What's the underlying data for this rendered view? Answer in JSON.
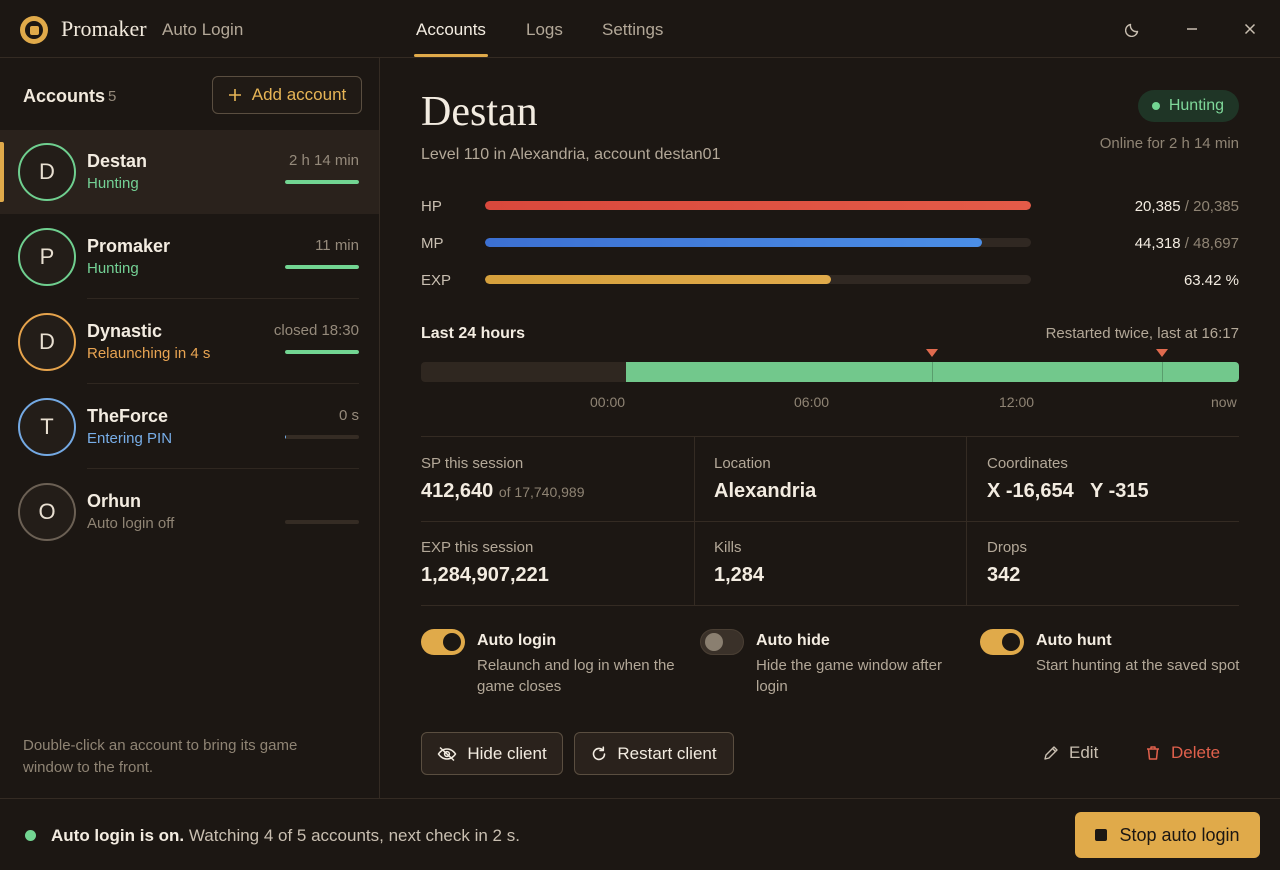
{
  "header": {
    "brand": "Promaker",
    "brand_sub": "Auto Login",
    "tabs": [
      {
        "label": "Accounts",
        "active": true
      },
      {
        "label": "Logs",
        "active": false
      },
      {
        "label": "Settings",
        "active": false
      }
    ],
    "icons": [
      "moon-icon",
      "minimize-icon",
      "close-icon"
    ]
  },
  "sidebar": {
    "title": "Accounts",
    "count": "5",
    "add_label": "Add account",
    "accounts": [
      {
        "initial": "D",
        "name": "Destan",
        "status": "Hunting",
        "status_color": "#74d195",
        "time": "2 h 14 min",
        "bar": 1.0,
        "bar_color": "#72d592",
        "ring": "#6fcf8f",
        "selected": true
      },
      {
        "initial": "P",
        "name": "Promaker",
        "status": "Hunting",
        "status_color": "#74d195",
        "time": "11 min",
        "bar": 1.0,
        "bar_color": "#72d592",
        "ring": "#6fcf8f",
        "selected": false
      },
      {
        "initial": "D",
        "name": "Dynastic",
        "status": "Relaunching in 4 s",
        "status_color": "#e8a452",
        "time": "closed 18:30",
        "bar": 1.0,
        "bar_color": "#72d592",
        "ring": "#e5a34c",
        "selected": false
      },
      {
        "initial": "T",
        "name": "TheForce",
        "status": "Entering PIN",
        "status_color": "#78aee8",
        "time": "0 s",
        "bar": 0.02,
        "bar_color": "#78aee8",
        "ring": "#74a9e3",
        "selected": false
      },
      {
        "initial": "O",
        "name": "Orhun",
        "status": "Auto login off",
        "status_color": "#8f8474",
        "time": "",
        "bar": 0.0,
        "bar_color": "#4a3f34",
        "ring": "#6b6054",
        "selected": false
      }
    ],
    "hint": "Double-click an account to bring its game window to the front."
  },
  "main": {
    "name": "Destan",
    "subtitle": "Level 110 in Alexandria, account destan01",
    "state": "Hunting",
    "online": "Online for 2 h 14 min",
    "stats": [
      {
        "label": "HP",
        "value": "20,385",
        "max": "/ 20,385",
        "fraction": 1.0,
        "color": "#d9483c",
        "color2": "#e45b48"
      },
      {
        "label": "MP",
        "value": "44,318",
        "max": "/ 48,697",
        "fraction": 0.91,
        "color": "#3c70d2",
        "color2": "#4b8ee6"
      },
      {
        "label": "EXP",
        "value": "63.42 %",
        "max": "",
        "fraction": 0.6342,
        "color": "#d5a03c",
        "color2": "#e0aa4a"
      }
    ],
    "timeline": {
      "title": "Last 24 hours",
      "note": "Restarted twice, last at 16:17",
      "online_start_fraction": 0.25,
      "restarts_fraction": [
        0.625,
        0.906
      ],
      "ticks": [
        "00:00",
        "06:00",
        "12:00",
        "now"
      ]
    },
    "cells": [
      {
        "label": "SP this session",
        "value": "412,640",
        "extra": "of 17,740,989"
      },
      {
        "label": "Location",
        "value": "Alexandria",
        "extra": ""
      },
      {
        "label": "Coordinates",
        "value": "X -16,654   Y -315",
        "extra": ""
      },
      {
        "label": "EXP this session",
        "value": "1,284,907,221",
        "extra": ""
      },
      {
        "label": "Kills",
        "value": "1,284",
        "extra": ""
      },
      {
        "label": "Drops",
        "value": "342",
        "extra": ""
      }
    ],
    "options": [
      {
        "title": "Auto login",
        "desc": "Relaunch and log in when the game closes",
        "on": true
      },
      {
        "title": "Auto hide",
        "desc": "Hide the game window after login",
        "on": false
      },
      {
        "title": "Auto hunt",
        "desc": "Start hunting at the saved spot",
        "on": true
      }
    ],
    "actions": {
      "hide": "Hide client",
      "restart": "Restart client",
      "edit": "Edit",
      "delete": "Delete"
    }
  },
  "footer": {
    "bold": "Auto login is on.",
    "text": "Watching 4 of 5 accounts, next check in 2 s.",
    "stop": "Stop auto login"
  },
  "colors": {
    "accent": "#e0aa4a",
    "success": "#72d592",
    "danger": "#e0604c"
  }
}
